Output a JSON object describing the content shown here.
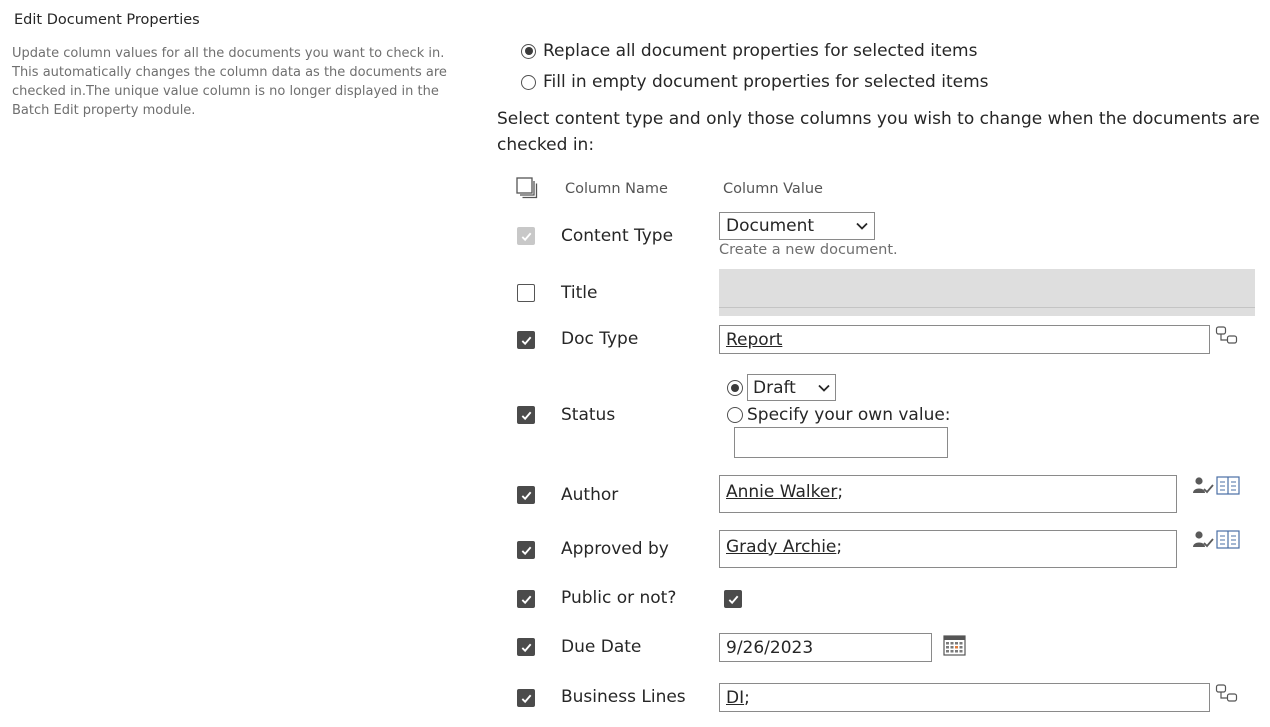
{
  "section": {
    "title": "Edit Document Properties",
    "description": "Update column values for all the documents you want to check in. This automatically changes the column data as the documents are checked in.The unique value column is no longer displayed in the Batch Edit property module."
  },
  "mode_options": [
    {
      "label": "Replace all document properties for selected items",
      "selected": true
    },
    {
      "label": "Fill in empty document properties for selected items",
      "selected": false
    }
  ],
  "intro_text": "Select content type and only those columns you wish to change when the documents are checked in:",
  "table_header": {
    "column_name": "Column Name",
    "column_value": "Column Value"
  },
  "rows": {
    "content_type": {
      "label": "Content Type",
      "checked": true,
      "disabled": true,
      "value": "Document",
      "hint": "Create a new document."
    },
    "title": {
      "label": "Title",
      "checked": false,
      "value": ""
    },
    "doc_type": {
      "label": "Doc Type",
      "checked": true,
      "value": "Report"
    },
    "status": {
      "label": "Status",
      "checked": true,
      "choice_value": "Draft",
      "own_value_label": "Specify your own value:",
      "own_value": "",
      "choice_selected": true
    },
    "author": {
      "label": "Author",
      "checked": true,
      "value": "Annie Walker",
      "suffix": ";"
    },
    "approved_by": {
      "label": "Approved by",
      "checked": true,
      "value": "Grady Archie",
      "suffix": ";"
    },
    "public": {
      "label": "Public or not?",
      "checked": true,
      "value_checked": true
    },
    "due_date": {
      "label": "Due Date",
      "checked": true,
      "value": "9/26/2023"
    },
    "business_lines": {
      "label": "Business Lines",
      "checked": true,
      "value": "DI",
      "suffix": ";"
    }
  },
  "colors": {
    "checkbox_checked": "#4b4b4b",
    "readonly_field": "#dedede",
    "icon_accent": "#4a6fa5"
  }
}
